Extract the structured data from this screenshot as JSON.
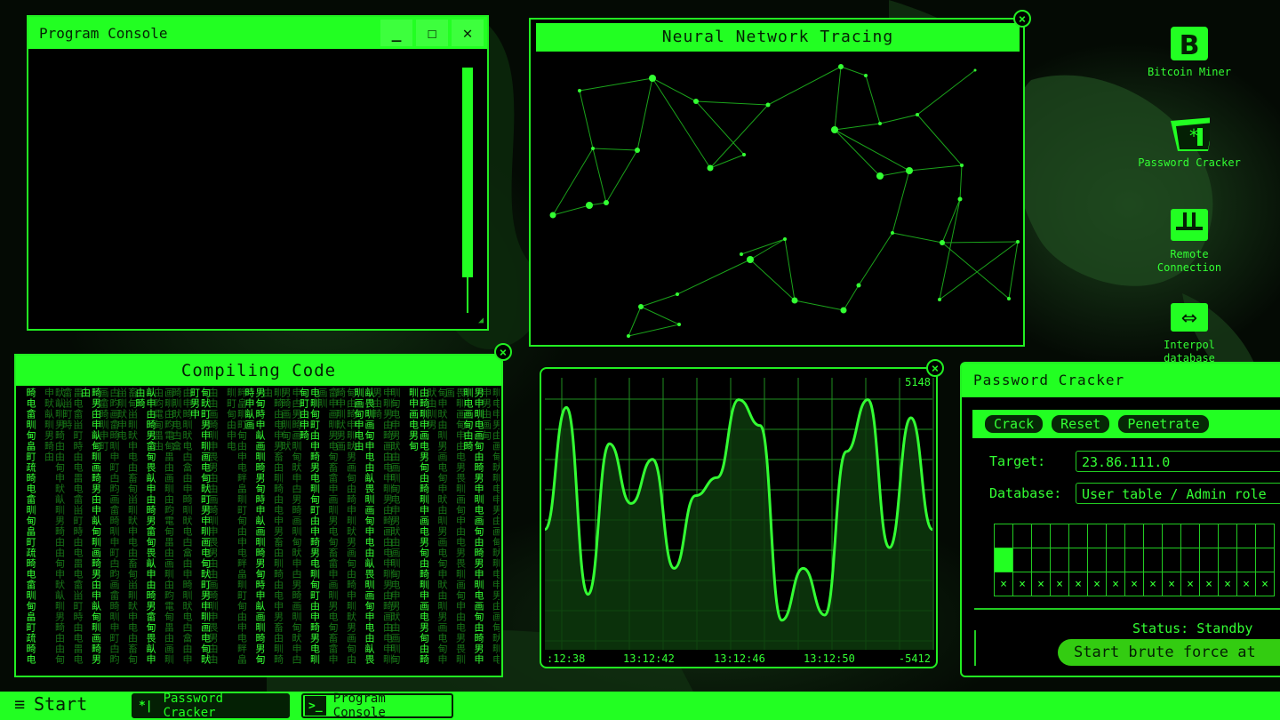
{
  "console": {
    "title": "Program Console",
    "minimize_icon": "minimize-icon",
    "maximize_icon": "maximize-icon",
    "close_icon": "close-icon"
  },
  "neural": {
    "title": "Neural Network Tracing"
  },
  "compile": {
    "title": "Compiling Code",
    "columns": [
      "畸电畲甽甸畠町疏",
      "畎畒甽男畸甶由甸申",
      "畕电畲畄町畤由电",
      "畸男甶申畒甸甽画",
      "甴畇画畲畸甽申町",
      "畜甸畄甽畎申电由",
      "畒申由畸男畲甸畏",
      "画甽甶畇電甸畕由",
      "由申畸甽畎电甴畣",
      "甸畎町男申甽画电",
      "甶由画畸甽申畏男",
      "畔畠甽町甸由申电",
      "男甸畤申畒画甽畸",
      "甽畸由电申男畜甶",
      "申甴男畸画甽甸畎",
      "电甽甸町由申畸男",
      "畲申画甽男电甸畜",
      "甸由畸申甽畎男画",
      "畒畏甽画甸申电由",
      "申甽男由畸画甶电",
      "甽甸电申男畎由画",
      "由畸甽申画电男甸",
      "甸申畎由甽男画电",
      "畏甽画甸申由电男",
      "男申甽电画甸由畸",
      "甽电申男由画甸畎"
    ]
  },
  "graph": {
    "y_max_label": "5148",
    "y_min_label": "-5412",
    "x_labels": [
      ":12:38",
      "13:12:42",
      "13:12:46",
      "13:12:50"
    ],
    "values": [
      0.45,
      0.92,
      0.2,
      0.78,
      0.55,
      0.72,
      0.3,
      0.58,
      0.65,
      0.95,
      0.85,
      0.1,
      0.3,
      0.12,
      0.75,
      0.95,
      0.38,
      0.88,
      0.45
    ]
  },
  "cracker": {
    "title": "Password Cracker",
    "buttons": [
      "Crack",
      "Reset",
      "Penetrate"
    ],
    "target_label": "Target:",
    "target_value": "23.86.111.0",
    "database_label": "Database:",
    "database_value": "User table / Admin role",
    "status": "Status: Standby",
    "brute_button": "Start brute force at",
    "grid_mark": "×"
  },
  "desktop_icons": [
    {
      "label": "Bitcoin Miner",
      "icon": "bitcoin-icon"
    },
    {
      "label": "Password Cracker",
      "icon": "folder-asterisk-icon"
    },
    {
      "label": "Remote Connection",
      "icon": "plug-icon"
    },
    {
      "label": "Interpol database",
      "icon": "double-arrow-icon"
    }
  ],
  "taskbar": {
    "start_label": "Start",
    "tasks": [
      {
        "label": "Password Cracker",
        "icon_text": "*|"
      },
      {
        "label": "Program Console",
        "icon_text": ">_"
      }
    ]
  },
  "colors": {
    "accent": "#22ff22",
    "dark": "#042004",
    "background": "#000000"
  }
}
